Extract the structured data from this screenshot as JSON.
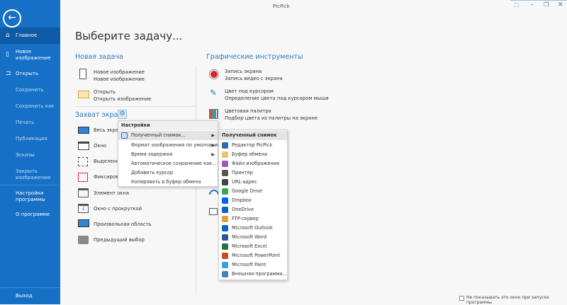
{
  "window": {
    "title": "PicPick",
    "controls": [
      "fullscreen",
      "minimize",
      "restore",
      "close"
    ]
  },
  "sidebar": {
    "items": [
      {
        "label": "Главное",
        "icon": "home-icon"
      },
      {
        "label": "Новое изображение",
        "icon": "file-icon"
      },
      {
        "label": "Открыть",
        "icon": "folder-icon"
      },
      {
        "label": "Сохранить"
      },
      {
        "label": "Сохранить как"
      },
      {
        "label": "Печать"
      },
      {
        "label": "Публикация"
      },
      {
        "label": "Эскизы"
      },
      {
        "label": "Закрыть изображение"
      },
      {
        "label": "Настройки программы"
      },
      {
        "label": "О программе"
      },
      {
        "label": "Выход"
      }
    ]
  },
  "main": {
    "heading": "Выберите задачу...",
    "new_task": {
      "title": "Новая задача",
      "items": [
        {
          "title": "Новое изображение",
          "sub": "Новое изображение"
        },
        {
          "title": "Открыть",
          "sub": "Открыть изображение"
        }
      ]
    },
    "capture": {
      "title": "Захват экрана",
      "items": [
        "Весь экран",
        "Окно",
        "Выделенная",
        "Фиксирован",
        "Элемент окна",
        "Окно с прокруткой",
        "Произвольная область",
        "Предыдущий выбор"
      ]
    },
    "graphics": {
      "title": "Графические инструменты",
      "items": [
        {
          "title": "Запись экрана",
          "sub": "Запись видео с экрана"
        },
        {
          "title": "Цвет под курсором",
          "sub": "Определение цвета под курсором мыши"
        },
        {
          "title": "Цветовая палитра",
          "sub": "Подбор цвета из палитры на экране"
        }
      ]
    }
  },
  "settings_menu": {
    "header": "Настройки",
    "items": [
      "Полученный снимок...",
      "Формат изображения по умолчанию",
      "Время задержки",
      "Автоматическое сохранение как...",
      "Добавить курсор",
      "Копировать в буфер обмена"
    ]
  },
  "submenu": {
    "header": "Полученный снимок",
    "items": [
      {
        "label": "Редактор PicPick",
        "color": "#2b6cb0"
      },
      {
        "label": "Буфер обмена",
        "color": "#e8c86a"
      },
      {
        "label": "Файл изображения",
        "color": "#9b59b6"
      },
      {
        "label": "Принтер",
        "color": "#555555"
      },
      {
        "label": "URL-адрес",
        "color": "#444444"
      },
      {
        "label": "Google Drive",
        "color": "#34a853"
      },
      {
        "label": "Dropbox",
        "color": "#0061fe"
      },
      {
        "label": "OneDrive",
        "color": "#0a64c8"
      },
      {
        "label": "FTP-сервер",
        "color": "#e0a040"
      },
      {
        "label": "Microsoft Outlook",
        "color": "#0a64c8"
      },
      {
        "label": "Microsoft Word",
        "color": "#2b579a"
      },
      {
        "label": "Microsoft Excel",
        "color": "#217346"
      },
      {
        "label": "Microsoft PowerPoint",
        "color": "#d24726"
      },
      {
        "label": "Microsoft Paint",
        "color": "#3aa0d8"
      },
      {
        "label": "Внешняя программа...",
        "color": "#4a7fb5"
      }
    ]
  },
  "footer": {
    "checkbox_label": "Не показывать это окно при запуске программы",
    "checked": false
  }
}
